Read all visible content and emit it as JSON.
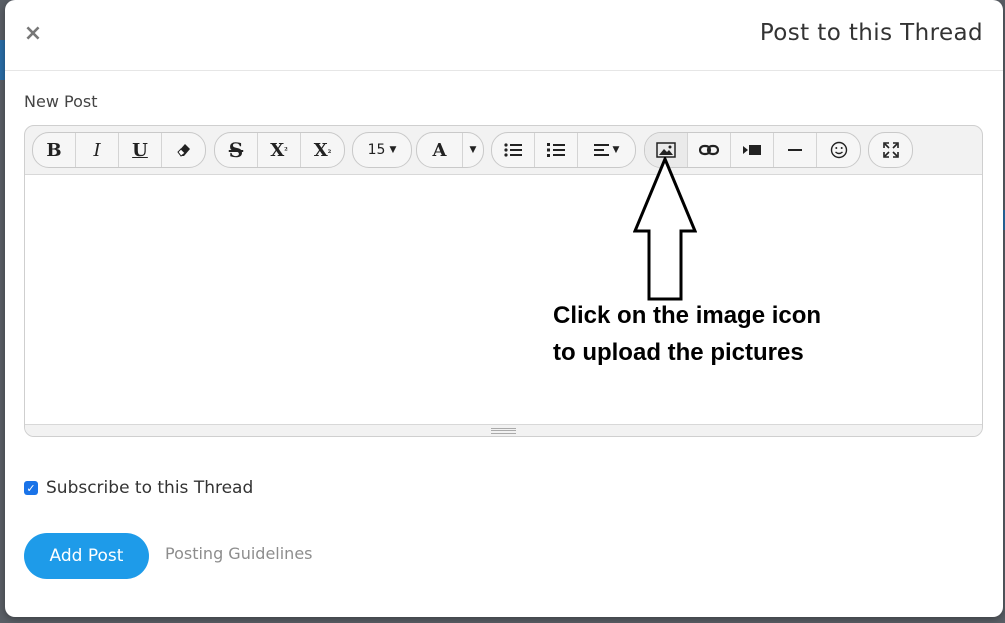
{
  "dialog": {
    "title": "Post to this Thread",
    "close_icon": "close-icon",
    "close_glyph": "×"
  },
  "form": {
    "field_label": "New Post",
    "font_size_value": "15",
    "editor_content": "",
    "subscribe": {
      "label": "Subscribe to this Thread",
      "checked": true
    },
    "submit_label": "Add Post",
    "guidelines_link": "Posting Guidelines"
  },
  "toolbar": {
    "bold": "B",
    "italic": "I",
    "underline": "U",
    "strikethrough": "S",
    "superscript": "X",
    "superscript_mark": "²",
    "subscript": "X",
    "subscript_mark": "₂",
    "font_color": "A",
    "icons": [
      "eraser-icon",
      "bulleted-list-icon",
      "numbered-list-icon",
      "align-icon",
      "image-icon",
      "link-icon",
      "video-icon",
      "horizontal-rule-icon",
      "emoji-icon",
      "fullscreen-icon"
    ]
  },
  "annotation": {
    "lines": [
      "Click on the image icon",
      "to upload the pictures"
    ]
  },
  "colors": {
    "primary_button": "#1e9be9",
    "checkbox": "#1a73e8"
  }
}
